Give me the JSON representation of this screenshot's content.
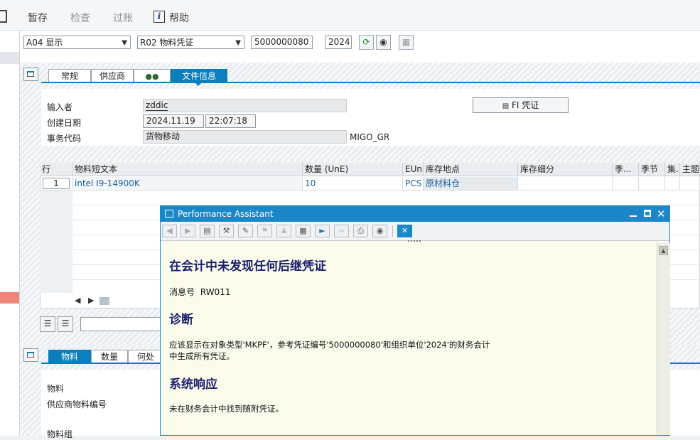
{
  "toolbar": {
    "save_draft": "暂存",
    "check": "检查",
    "post": "过账",
    "help": "帮助"
  },
  "header": {
    "action_select": "A04 显示",
    "doc_type_select": "R02 物料凭证",
    "doc_number": "5000000080",
    "year": "2024"
  },
  "header_tabs": [
    "常规",
    "供应商",
    "",
    "文件信息"
  ],
  "docinfo": {
    "entered_by_label": "输入者",
    "entered_by": "zddic",
    "created_label": "创建日期",
    "created_date": "2024.11.19",
    "created_time": "22:07:18",
    "tcode_label": "事务代码",
    "tcode_text": "货物移动",
    "tcode": "MIGO_GR",
    "fi_button": "FI 凭证"
  },
  "table": {
    "headers": [
      "行",
      "物料短文本",
      "数量 (UnE)",
      "EUn",
      "库存地点",
      "库存细分",
      "季...",
      "季节",
      "集.",
      "主题"
    ],
    "rows": [
      {
        "line": "1",
        "text": "intel I9-14900K",
        "qty": "10",
        "unit": "PCS",
        "sloc": "原材料仓"
      }
    ]
  },
  "item_tabs": [
    "物料",
    "数量",
    "何处"
  ],
  "item_fields": {
    "material": "物料",
    "vendor_material": "供应商物料编号",
    "material_group": "物料组"
  },
  "popup": {
    "title": "Performance Assistant",
    "heading": "在会计中未发现任何后继凭证",
    "msg_label": "消息号",
    "msg_no": "RW011",
    "diag_heading": "诊断",
    "diag_line1": "应该显示在对象类型'MKPF'，参考凭证编号'5000000080'和组织单位'2024'的财务会计",
    "diag_line2": "中生成所有凭证。",
    "resp_heading": "系统响应",
    "resp_text": "未在财务会计中找到随附凭证。"
  },
  "colors": {
    "accent": "#0b7fbd",
    "popup_bg": "#fbfbec",
    "link": "#1d5e9e",
    "heading": "#1a1f6b"
  }
}
